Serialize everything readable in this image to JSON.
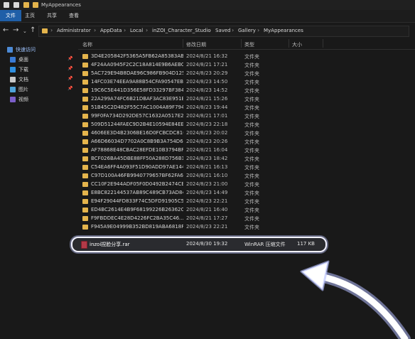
{
  "window": {
    "title": "MyAppearances"
  },
  "ribbon": {
    "tabs": [
      "文件",
      "主页",
      "共享",
      "查看"
    ]
  },
  "address": {
    "breadcrumbs": [
      "Administrator",
      "AppData",
      "Local",
      "inZOI_Character_Studio",
      "Saved",
      "Gallery",
      "MyAppearances"
    ]
  },
  "sidebar": {
    "quick_access": "快速访问",
    "items": [
      {
        "label": "桌面",
        "icon": "desktop-icon"
      },
      {
        "label": "下载",
        "icon": "download-icon"
      },
      {
        "label": "文档",
        "icon": "document-icon"
      },
      {
        "label": "图片",
        "icon": "picture-icon"
      },
      {
        "label": "视频",
        "icon": "video-icon"
      }
    ]
  },
  "columns": {
    "name": "名称",
    "date": "修改日期",
    "type": "类型",
    "size": "大小"
  },
  "files": [
    {
      "name": "3D4E205842F5365A5FB62A85383AB0...",
      "date": "2024/8/21 16:32",
      "type": "文件夹"
    },
    {
      "name": "4F24AA0945F2C2C18A814E9B6AEBC6...",
      "date": "2024/8/21 17:21",
      "type": "文件夹"
    },
    {
      "name": "5AC729E94B8DAE96C986FB904D125...",
      "date": "2024/8/23 20:29",
      "type": "文件夹"
    },
    {
      "name": "14FC03E74EEA9A88B54CFA90547EB2...",
      "date": "2024/8/23 14:50",
      "type": "文件夹"
    },
    {
      "name": "19C6C5E441D356E58FD33297BF384F...",
      "date": "2024/8/23 14:52",
      "type": "文件夹"
    },
    {
      "name": "22A299A74FC6B21DBAF3AC83E951E...",
      "date": "2024/8/21 15:26",
      "type": "文件夹"
    },
    {
      "name": "51B45C2D482F55C7AC1004A89F7948...",
      "date": "2024/8/23 19:44",
      "type": "文件夹"
    },
    {
      "name": "99F0FA734D292DE57C1632A0517E2C...",
      "date": "2024/8/21 17:01",
      "type": "文件夹"
    },
    {
      "name": "509D51244FAEC9D2B4E10594E84EE...",
      "date": "2024/8/23 22:18",
      "type": "文件夹"
    },
    {
      "name": "4606EE3D4B2306BE16D0FCBCDC810...",
      "date": "2024/8/23 20:02",
      "type": "文件夹"
    },
    {
      "name": "A66D66034D7702A0C8B9B3A754D61...",
      "date": "2024/8/23 20:26",
      "type": "文件夹"
    },
    {
      "name": "AF78868E48CBAC28EFDE10B3794BF3...",
      "date": "2024/8/21 16:04",
      "type": "文件夹"
    },
    {
      "name": "BCF026BA45DBE88FF50A288D756B1...",
      "date": "2024/8/23 18:42",
      "type": "文件夹"
    },
    {
      "name": "C54EA6FF4A093F51D90ADD97AE144...",
      "date": "2024/8/21 16:13",
      "type": "文件夹"
    },
    {
      "name": "C97D100A46FB9940779657BF62FA60...",
      "date": "2024/8/21 16:10",
      "type": "文件夹"
    },
    {
      "name": "CC10F2E944ADF05F0D0492B2474CE0...",
      "date": "2024/8/23 21:00",
      "type": "文件夹"
    },
    {
      "name": "E8BC822144537AB89C489CB73AD84...",
      "date": "2024/8/23 14:49",
      "type": "文件夹"
    },
    {
      "name": "E94F29044FD833F74C5DFD91905C5B...",
      "date": "2024/8/23 22:21",
      "type": "文件夹"
    },
    {
      "name": "ED4BC2614E4B9F68199226B26362CA...",
      "date": "2024/8/21 16:40",
      "type": "文件夹"
    },
    {
      "name": "F9FBDDEC4E28D4226FC2BA35C46...",
      "date": "2024/8/21 17:27",
      "type": "文件夹"
    },
    {
      "name": "F945A9E04999B352BD819ABA6818F3...",
      "date": "2024/8/23 22:21",
      "type": "文件夹"
    }
  ],
  "highlighted_file": {
    "name": "inzoi捏脸分享.rar",
    "date": "2024/8/30 19:32",
    "type": "WinRAR 压缩文件",
    "size": "117 KB"
  },
  "colors": {
    "accent": "#1f5fa8",
    "folder": "#e4b44c",
    "highlight_ring": "#f2f2ff"
  }
}
